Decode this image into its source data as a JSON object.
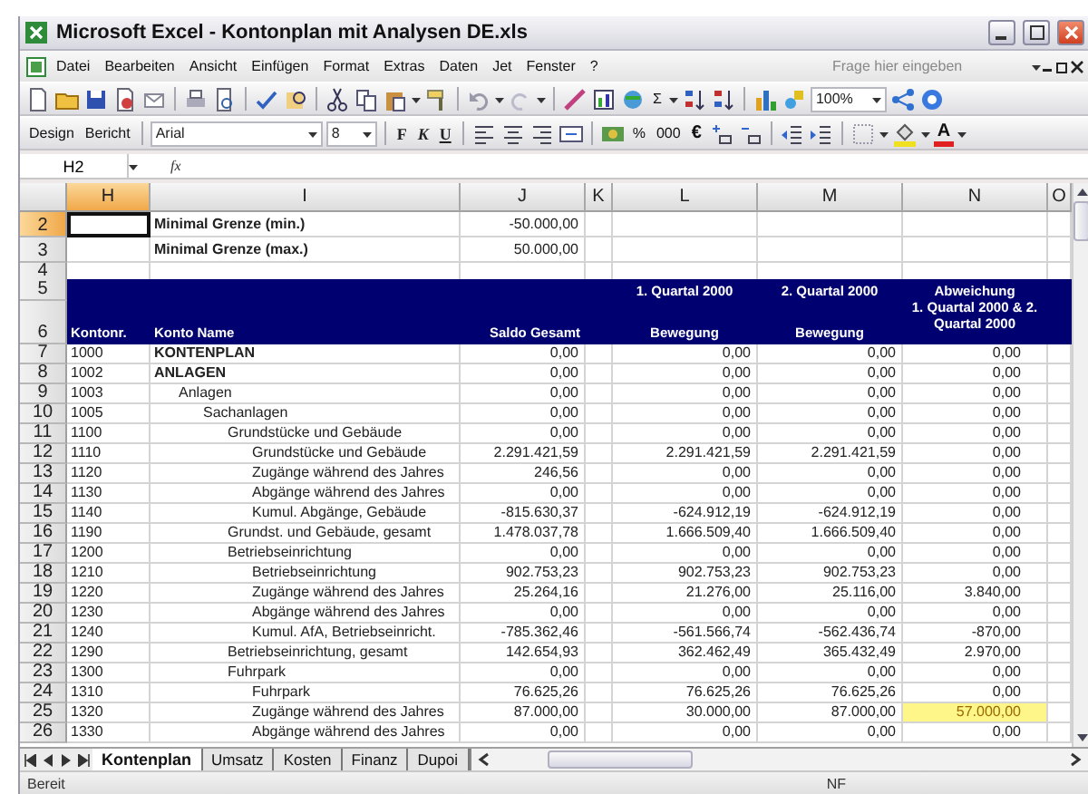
{
  "window": {
    "title": "Microsoft Excel - Kontonplan mit Analysen DE.xls"
  },
  "menu": [
    "Datei",
    "Bearbeiten",
    "Ansicht",
    "Einfügen",
    "Format",
    "Extras",
    "Daten",
    "Jet",
    "Fenster",
    "?"
  ],
  "help_search": {
    "placeholder": "Frage hier eingeben"
  },
  "standard_toolbar": {
    "autosum": "Σ",
    "zoom": "100%"
  },
  "format_toolbar": {
    "buttons": [
      "Design",
      "Bericht"
    ],
    "font": "Arial",
    "size": "8",
    "bold": "F",
    "italic": "K",
    "underline": "U",
    "percent": "%",
    "thousands": "000",
    "currency": "€",
    "font_color": "A"
  },
  "formula_bar": {
    "name_box": "H2",
    "function_label": "fx"
  },
  "columns": [
    {
      "label": "H",
      "selected": true
    },
    {
      "label": "I",
      "selected": false
    },
    {
      "label": "J",
      "selected": false
    },
    {
      "label": "K",
      "selected": false
    },
    {
      "label": "L",
      "selected": false
    },
    {
      "label": "M",
      "selected": false
    },
    {
      "label": "N",
      "selected": false
    },
    {
      "label": "O",
      "selected": false
    }
  ],
  "row_headers": [
    {
      "label": "2",
      "selected": true
    },
    {
      "label": "3",
      "selected": false
    },
    {
      "label": "4",
      "selected": false
    },
    {
      "label": "5",
      "selected": false
    },
    {
      "label": "6",
      "selected": false
    },
    {
      "label": "7",
      "selected": false
    },
    {
      "label": "8",
      "selected": false
    },
    {
      "label": "9",
      "selected": false
    },
    {
      "label": "10",
      "selected": false
    },
    {
      "label": "11",
      "selected": false
    },
    {
      "label": "12",
      "selected": false
    },
    {
      "label": "13",
      "selected": false
    },
    {
      "label": "14",
      "selected": false
    },
    {
      "label": "15",
      "selected": false
    },
    {
      "label": "16",
      "selected": false
    },
    {
      "label": "17",
      "selected": false
    },
    {
      "label": "18",
      "selected": false
    },
    {
      "label": "19",
      "selected": false
    },
    {
      "label": "20",
      "selected": false
    },
    {
      "label": "21",
      "selected": false
    },
    {
      "label": "22",
      "selected": false
    },
    {
      "label": "23",
      "selected": false
    },
    {
      "label": "24",
      "selected": false
    },
    {
      "label": "25",
      "selected": false
    },
    {
      "label": "26",
      "selected": false
    }
  ],
  "limits": [
    {
      "label": "Minimal Grenze (min.)",
      "value": "-50.000,00",
      "active": true
    },
    {
      "label": "Minimal Grenze (max.)",
      "value": "50.000,00",
      "active": false
    }
  ],
  "table_header": {
    "account": "Kontonr.",
    "name": "Konto Name",
    "saldo": "Saldo Gesamt",
    "q1": [
      "1. Quartal 2000",
      "Bewegung"
    ],
    "q2": [
      "2. Quartal 2000",
      "Bewegung"
    ],
    "deviation": [
      "Abweichung",
      "1. Quartal 2000 & 2. Quartal 2000"
    ]
  },
  "rows": [
    {
      "account": "1000",
      "name": "KONTENPLAN",
      "saldo": "0,00",
      "q1": "0,00",
      "q2": "0,00",
      "deviation": "0,00",
      "flagged": false
    },
    {
      "account": "1002",
      "name": "ANLAGEN",
      "saldo": "0,00",
      "q1": "0,00",
      "q2": "0,00",
      "deviation": "0,00",
      "flagged": false,
      "children": [
        {
          "account": "1003",
          "name": "Anlagen",
          "saldo": "0,00",
          "q1": "0,00",
          "q2": "0,00",
          "deviation": "0,00",
          "flagged": false,
          "children": [
            {
              "account": "1005",
              "name": "Sachanlagen",
              "saldo": "0,00",
              "q1": "0,00",
              "q2": "0,00",
              "deviation": "0,00",
              "flagged": false,
              "children": [
                {
                  "account": "1100",
                  "name": "Grundstücke und Gebäude",
                  "saldo": "0,00",
                  "q1": "0,00",
                  "q2": "0,00",
                  "deviation": "0,00",
                  "flagged": false,
                  "children": [
                    {
                      "account": "1110",
                      "name": "Grundstücke und Gebäude",
                      "saldo": "2.291.421,59",
                      "q1": "2.291.421,59",
                      "q2": "2.291.421,59",
                      "deviation": "0,00",
                      "flagged": false
                    },
                    {
                      "account": "1120",
                      "name": "Zugänge während des Jahres",
                      "saldo": "246,56",
                      "q1": "0,00",
                      "q2": "0,00",
                      "deviation": "0,00",
                      "flagged": false
                    },
                    {
                      "account": "1130",
                      "name": "Abgänge während des Jahres",
                      "saldo": "0,00",
                      "q1": "0,00",
                      "q2": "0,00",
                      "deviation": "0,00",
                      "flagged": false
                    },
                    {
                      "account": "1140",
                      "name": "Kumul. Abgänge, Gebäude",
                      "saldo": "-815.630,37",
                      "q1": "-624.912,19",
                      "q2": "-624.912,19",
                      "deviation": "0,00",
                      "flagged": false
                    }
                  ]
                },
                {
                  "account": "1190",
                  "name": "Grundst. und Gebäude, gesamt",
                  "saldo": "1.478.037,78",
                  "q1": "1.666.509,40",
                  "q2": "1.666.509,40",
                  "deviation": "0,00",
                  "flagged": false
                },
                {
                  "account": "1200",
                  "name": "Betriebseinrichtung",
                  "saldo": "0,00",
                  "q1": "0,00",
                  "q2": "0,00",
                  "deviation": "0,00",
                  "flagged": false,
                  "children": [
                    {
                      "account": "1210",
                      "name": "Betriebseinrichtung",
                      "saldo": "902.753,23",
                      "q1": "902.753,23",
                      "q2": "902.753,23",
                      "deviation": "0,00",
                      "flagged": false
                    },
                    {
                      "account": "1220",
                      "name": "Zugänge während des Jahres",
                      "saldo": "25.264,16",
                      "q1": "21.276,00",
                      "q2": "25.116,00",
                      "deviation": "3.840,00",
                      "flagged": false
                    },
                    {
                      "account": "1230",
                      "name": "Abgänge während des Jahres",
                      "saldo": "0,00",
                      "q1": "0,00",
                      "q2": "0,00",
                      "deviation": "0,00",
                      "flagged": false
                    },
                    {
                      "account": "1240",
                      "name": "Kumul. AfA, Betriebseinricht.",
                      "saldo": "-785.362,46",
                      "q1": "-561.566,74",
                      "q2": "-562.436,74",
                      "deviation": "-870,00",
                      "flagged": false
                    }
                  ]
                },
                {
                  "account": "1290",
                  "name": "Betriebseinrichtung, gesamt",
                  "saldo": "142.654,93",
                  "q1": "362.462,49",
                  "q2": "365.432,49",
                  "deviation": "2.970,00",
                  "flagged": false
                },
                {
                  "account": "1300",
                  "name": "Fuhrpark",
                  "saldo": "0,00",
                  "q1": "0,00",
                  "q2": "0,00",
                  "deviation": "0,00",
                  "flagged": false,
                  "children": [
                    {
                      "account": "1310",
                      "name": "Fuhrpark",
                      "saldo": "76.625,26",
                      "q1": "76.625,26",
                      "q2": "76.625,26",
                      "deviation": "0,00",
                      "flagged": false
                    },
                    {
                      "account": "1320",
                      "name": "Zugänge während des Jahres",
                      "saldo": "87.000,00",
                      "q1": "30.000,00",
                      "q2": "87.000,00",
                      "deviation": "57.000,00",
                      "flagged": true
                    },
                    {
                      "account": "1330",
                      "name": "Abgänge während des Jahres",
                      "saldo": "0,00",
                      "q1": "0,00",
                      "q2": "0,00",
                      "deviation": "0,00",
                      "flagged": false
                    }
                  ]
                }
              ]
            }
          ]
        }
      ]
    }
  ],
  "sheet_tabs": [
    {
      "label": "Kontenplan",
      "selected": true
    },
    {
      "label": "Umsatz",
      "selected": false
    },
    {
      "label": "Kosten",
      "selected": false
    },
    {
      "label": "Finanz",
      "selected": false
    },
    {
      "label": "Dupoi",
      "selected": false
    }
  ],
  "status_bar": {
    "message": "Bereit",
    "indicator": "NF"
  }
}
